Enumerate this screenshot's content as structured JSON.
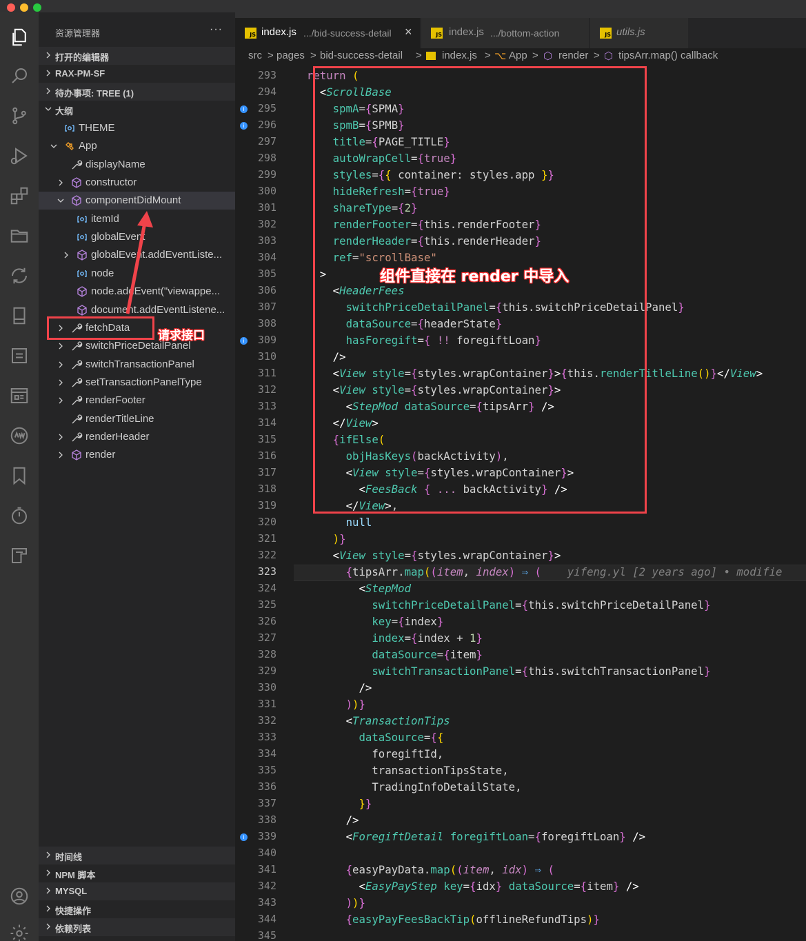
{
  "sidebar": {
    "title": "资源管理器",
    "more": "···",
    "sections_top": [
      {
        "label": "打开的编辑器"
      },
      {
        "label": "RAX-PM-SF"
      },
      {
        "label": "待办事项: TREE (1)"
      },
      {
        "label": "大纲"
      }
    ],
    "outline": [
      {
        "label": "THEME"
      },
      {
        "label": "App"
      },
      {
        "label": "displayName"
      },
      {
        "label": "constructor"
      },
      {
        "label": "componentDidMount"
      },
      {
        "label": "itemId"
      },
      {
        "label": "globalEvent"
      },
      {
        "label": "globalEvent.addEventListe..."
      },
      {
        "label": "node"
      },
      {
        "label": "node.addEvent(\"viewappe..."
      },
      {
        "label": "document.addEventListene..."
      },
      {
        "label": "fetchData"
      },
      {
        "label": "switchPriceDetailPanel"
      },
      {
        "label": "switchTransactionPanel"
      },
      {
        "label": "setTransactionPanelType"
      },
      {
        "label": "renderFooter"
      },
      {
        "label": "renderTitleLine"
      },
      {
        "label": "renderHeader"
      },
      {
        "label": "render"
      }
    ],
    "sections_bottom": [
      {
        "label": "时间线"
      },
      {
        "label": "NPM 脚本"
      },
      {
        "label": "MYSQL"
      },
      {
        "label": "快捷操作"
      },
      {
        "label": "依赖列表"
      }
    ]
  },
  "tabs": [
    {
      "icon": "JS",
      "name": "index.js",
      "path": ".../bid-success-detail",
      "close": "×"
    },
    {
      "icon": "JS",
      "name": "index.js",
      "path": ".../bottom-action"
    },
    {
      "icon": "JS",
      "name": "utils.js",
      "path": ""
    }
  ],
  "breadcrumb": [
    "src",
    "pages",
    "bid-success-detail",
    "index.js",
    "App",
    "render",
    "tipsArr.map() callback"
  ],
  "breadcrumb_sep": ">",
  "editor": {
    "line_start": 293,
    "line_end": 345,
    "current_line": 323,
    "info_lines": [
      295,
      296,
      309,
      339
    ],
    "blame": "yifeng.yl [2 years ago] • modifie"
  },
  "annotations": {
    "render_note": "组件直接在 render 中导入",
    "fetch_note": "请求接口"
  },
  "colors": {
    "highlight_box": "#f0434a",
    "editor_bg": "#1e1e1e",
    "sidebar_bg": "#252526",
    "activity_bg": "#333333"
  }
}
